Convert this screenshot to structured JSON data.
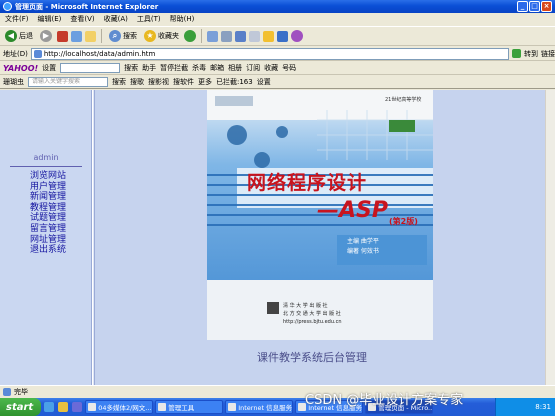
{
  "window": {
    "title": "管理页面 - Microsoft Internet Explorer",
    "min": "_",
    "max": "□",
    "close": "×"
  },
  "menu": [
    "文件(F)",
    "编辑(E)",
    "查看(V)",
    "收藏(A)",
    "工具(T)",
    "帮助(H)"
  ],
  "toolbar": {
    "back": "后退",
    "search": "搜索",
    "favorites": "收藏夹"
  },
  "address": {
    "label": "地址(D)",
    "url": "http://localhost/data/admin.htm",
    "go": "转到",
    "links": "链接"
  },
  "yahoo_bar": {
    "logo": "YAHOO!",
    "settings": "设置",
    "search": "搜索",
    "help": "助手",
    "block": "暂停拦截",
    "kill": "杀毒",
    "mail": "邮箱",
    "album": "相册",
    "subscribe": "订阅",
    "favorites": "收藏",
    "plus": "号码"
  },
  "third_bar": {
    "brand": "珊瑚虫",
    "placeholder": "请输入关键字搜索",
    "search": "搜索",
    "music": "搜歌",
    "video": "搜影视",
    "software": "搜软件",
    "more": "更多",
    "blocked": "已拦截:163",
    "settings": "设置"
  },
  "left": {
    "title": "admin",
    "nav": [
      "浏览网站",
      "用户管理",
      "新闻管理",
      "教程管理",
      "试题管理",
      "留言管理",
      "网址管理",
      "退出系统"
    ]
  },
  "book": {
    "title": "网络程序设计",
    "subtitle": "—ASP",
    "edition": "(第2版)",
    "author1": "主编  曲学平",
    "author2": "编著  何效书",
    "publisher": "清 华 大 学 出 版 社",
    "publisher2": "北 方 交 通 大 学 出 版 社",
    "url": "http://press.bjtu.edu.cn",
    "top": "21世纪高等学校"
  },
  "caption": "课件教学系统后台管理",
  "status": {
    "text": "完毕"
  },
  "taskbar": {
    "start": "start",
    "tasks": [
      "04多媒体2/网文...",
      "管理工具",
      "Internet 信息服务",
      "Internet 信息服务",
      "管理页面 - Micro..."
    ],
    "time": "8:31"
  },
  "watermark": "CSDN @毕业设计方案专家",
  "colors": {
    "title_bar": "#0a4fd6",
    "nav_link": "#1515a0",
    "content_bg": "#c6d3ee"
  }
}
